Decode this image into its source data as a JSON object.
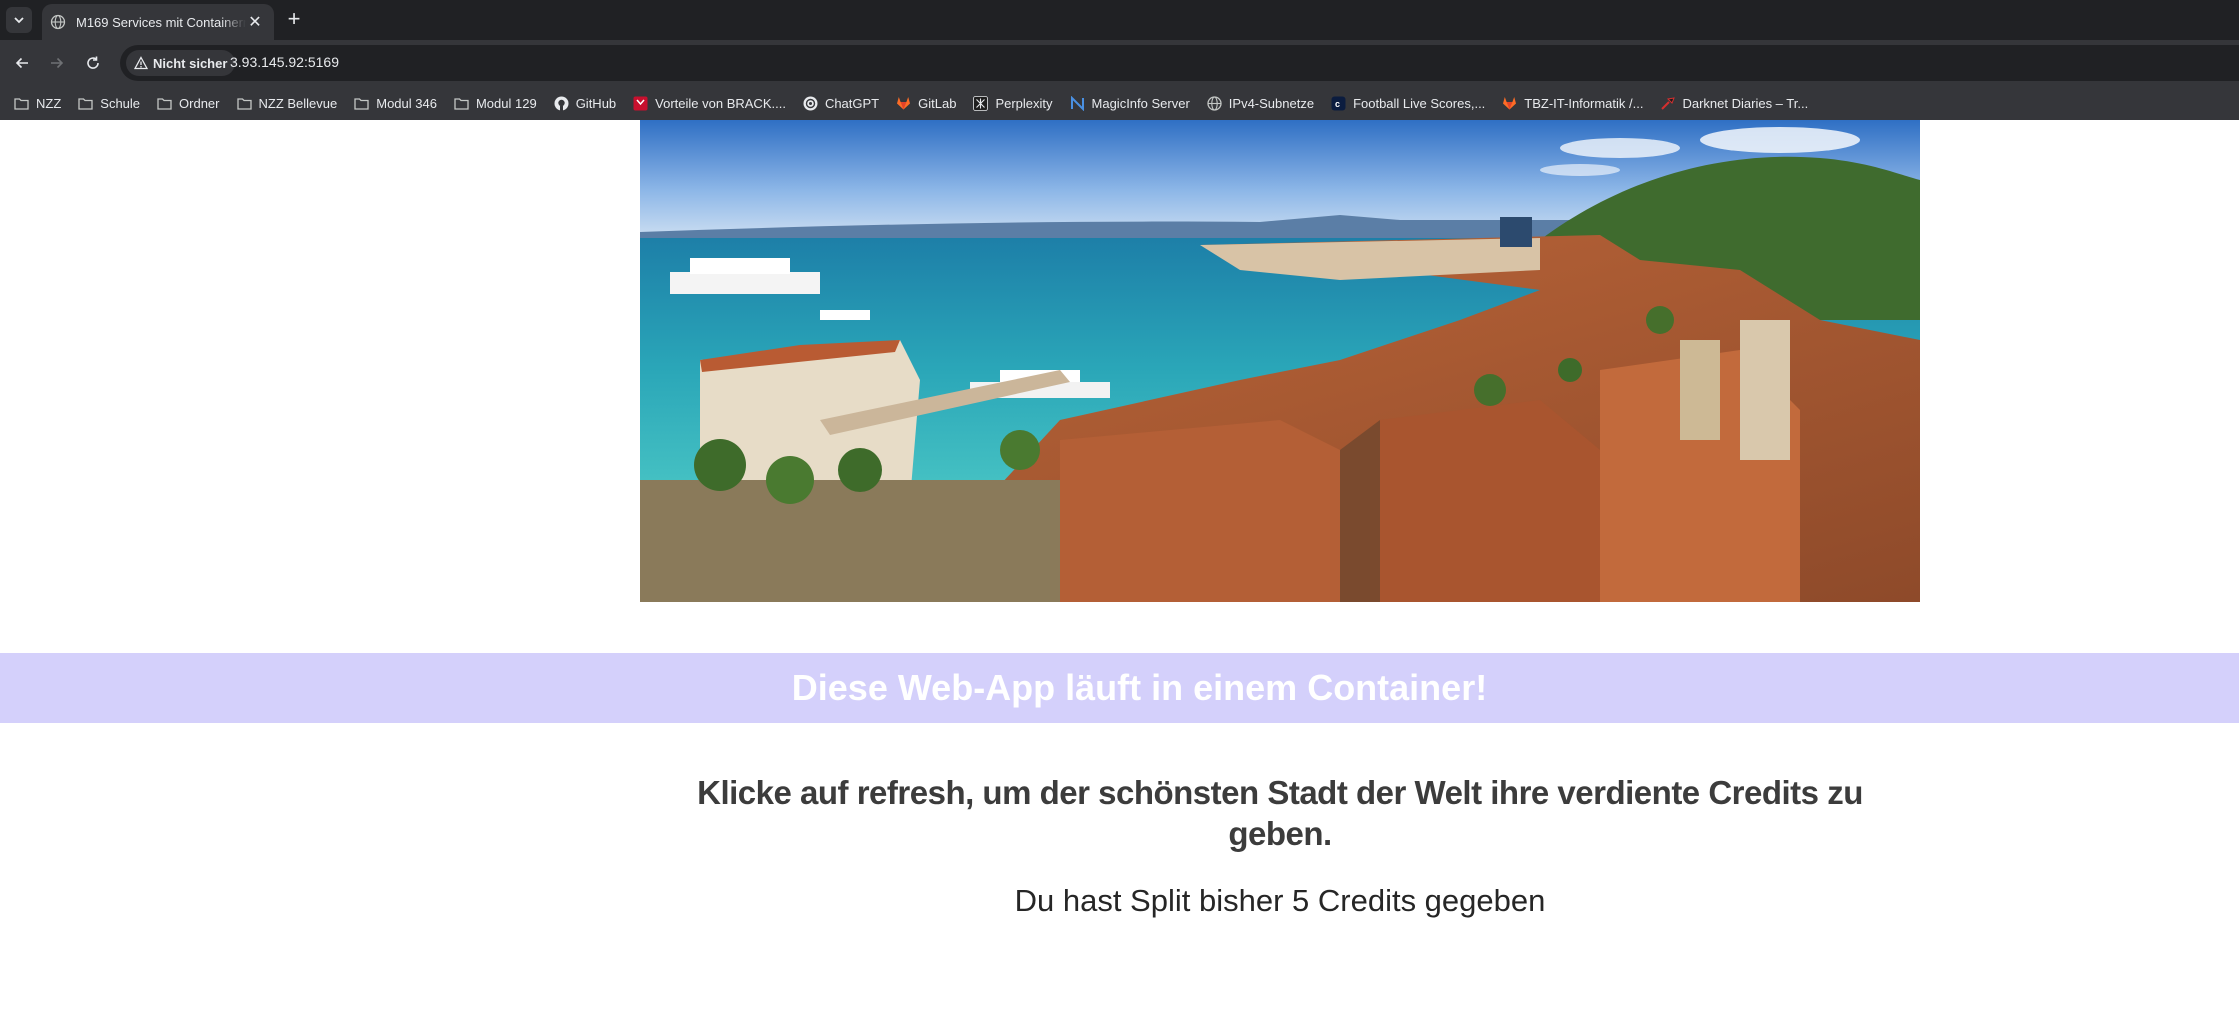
{
  "browser": {
    "tab": {
      "title": "M169 Services mit Containern betreiben"
    },
    "new_tab_label": "+",
    "security_label": "Nicht sicher",
    "url": "3.93.145.92:5169"
  },
  "bookmarks": [
    {
      "label": "NZZ",
      "icon": "folder-icon"
    },
    {
      "label": "Schule",
      "icon": "folder-icon"
    },
    {
      "label": "Ordner",
      "icon": "folder-icon"
    },
    {
      "label": "NZZ Bellevue",
      "icon": "folder-icon"
    },
    {
      "label": "Modul 346",
      "icon": "folder-icon"
    },
    {
      "label": "Modul 129",
      "icon": "folder-icon"
    },
    {
      "label": "GitHub",
      "icon": "github-icon"
    },
    {
      "label": "Vorteile von BRACK....",
      "icon": "brack-icon"
    },
    {
      "label": "ChatGPT",
      "icon": "chatgpt-icon"
    },
    {
      "label": "GitLab",
      "icon": "gitlab-icon"
    },
    {
      "label": "Perplexity",
      "icon": "perplexity-icon"
    },
    {
      "label": "MagicInfo Server",
      "icon": "magicinfo-icon"
    },
    {
      "label": "IPv4-Subnetze",
      "icon": "globe-icon"
    },
    {
      "label": "Football Live Scores,...",
      "icon": "football-icon"
    },
    {
      "label": "TBZ-IT-Informatik /...",
      "icon": "gitlab-icon"
    },
    {
      "label": "Darknet Diaries – Tr...",
      "icon": "darknet-icon"
    }
  ],
  "page": {
    "banner_text": "Diese Web-App läuft in einem Container!",
    "headline": "Klicke auf refresh, um der schönsten Stadt der Welt ihre verdiente Credits zu geben.",
    "credits_text": "Du hast Split bisher 5 Credits gegeben"
  },
  "colors": {
    "banner_bg": "#d4d0fb",
    "browser_dark": "#202124",
    "browser_toolbar": "#35363a"
  }
}
